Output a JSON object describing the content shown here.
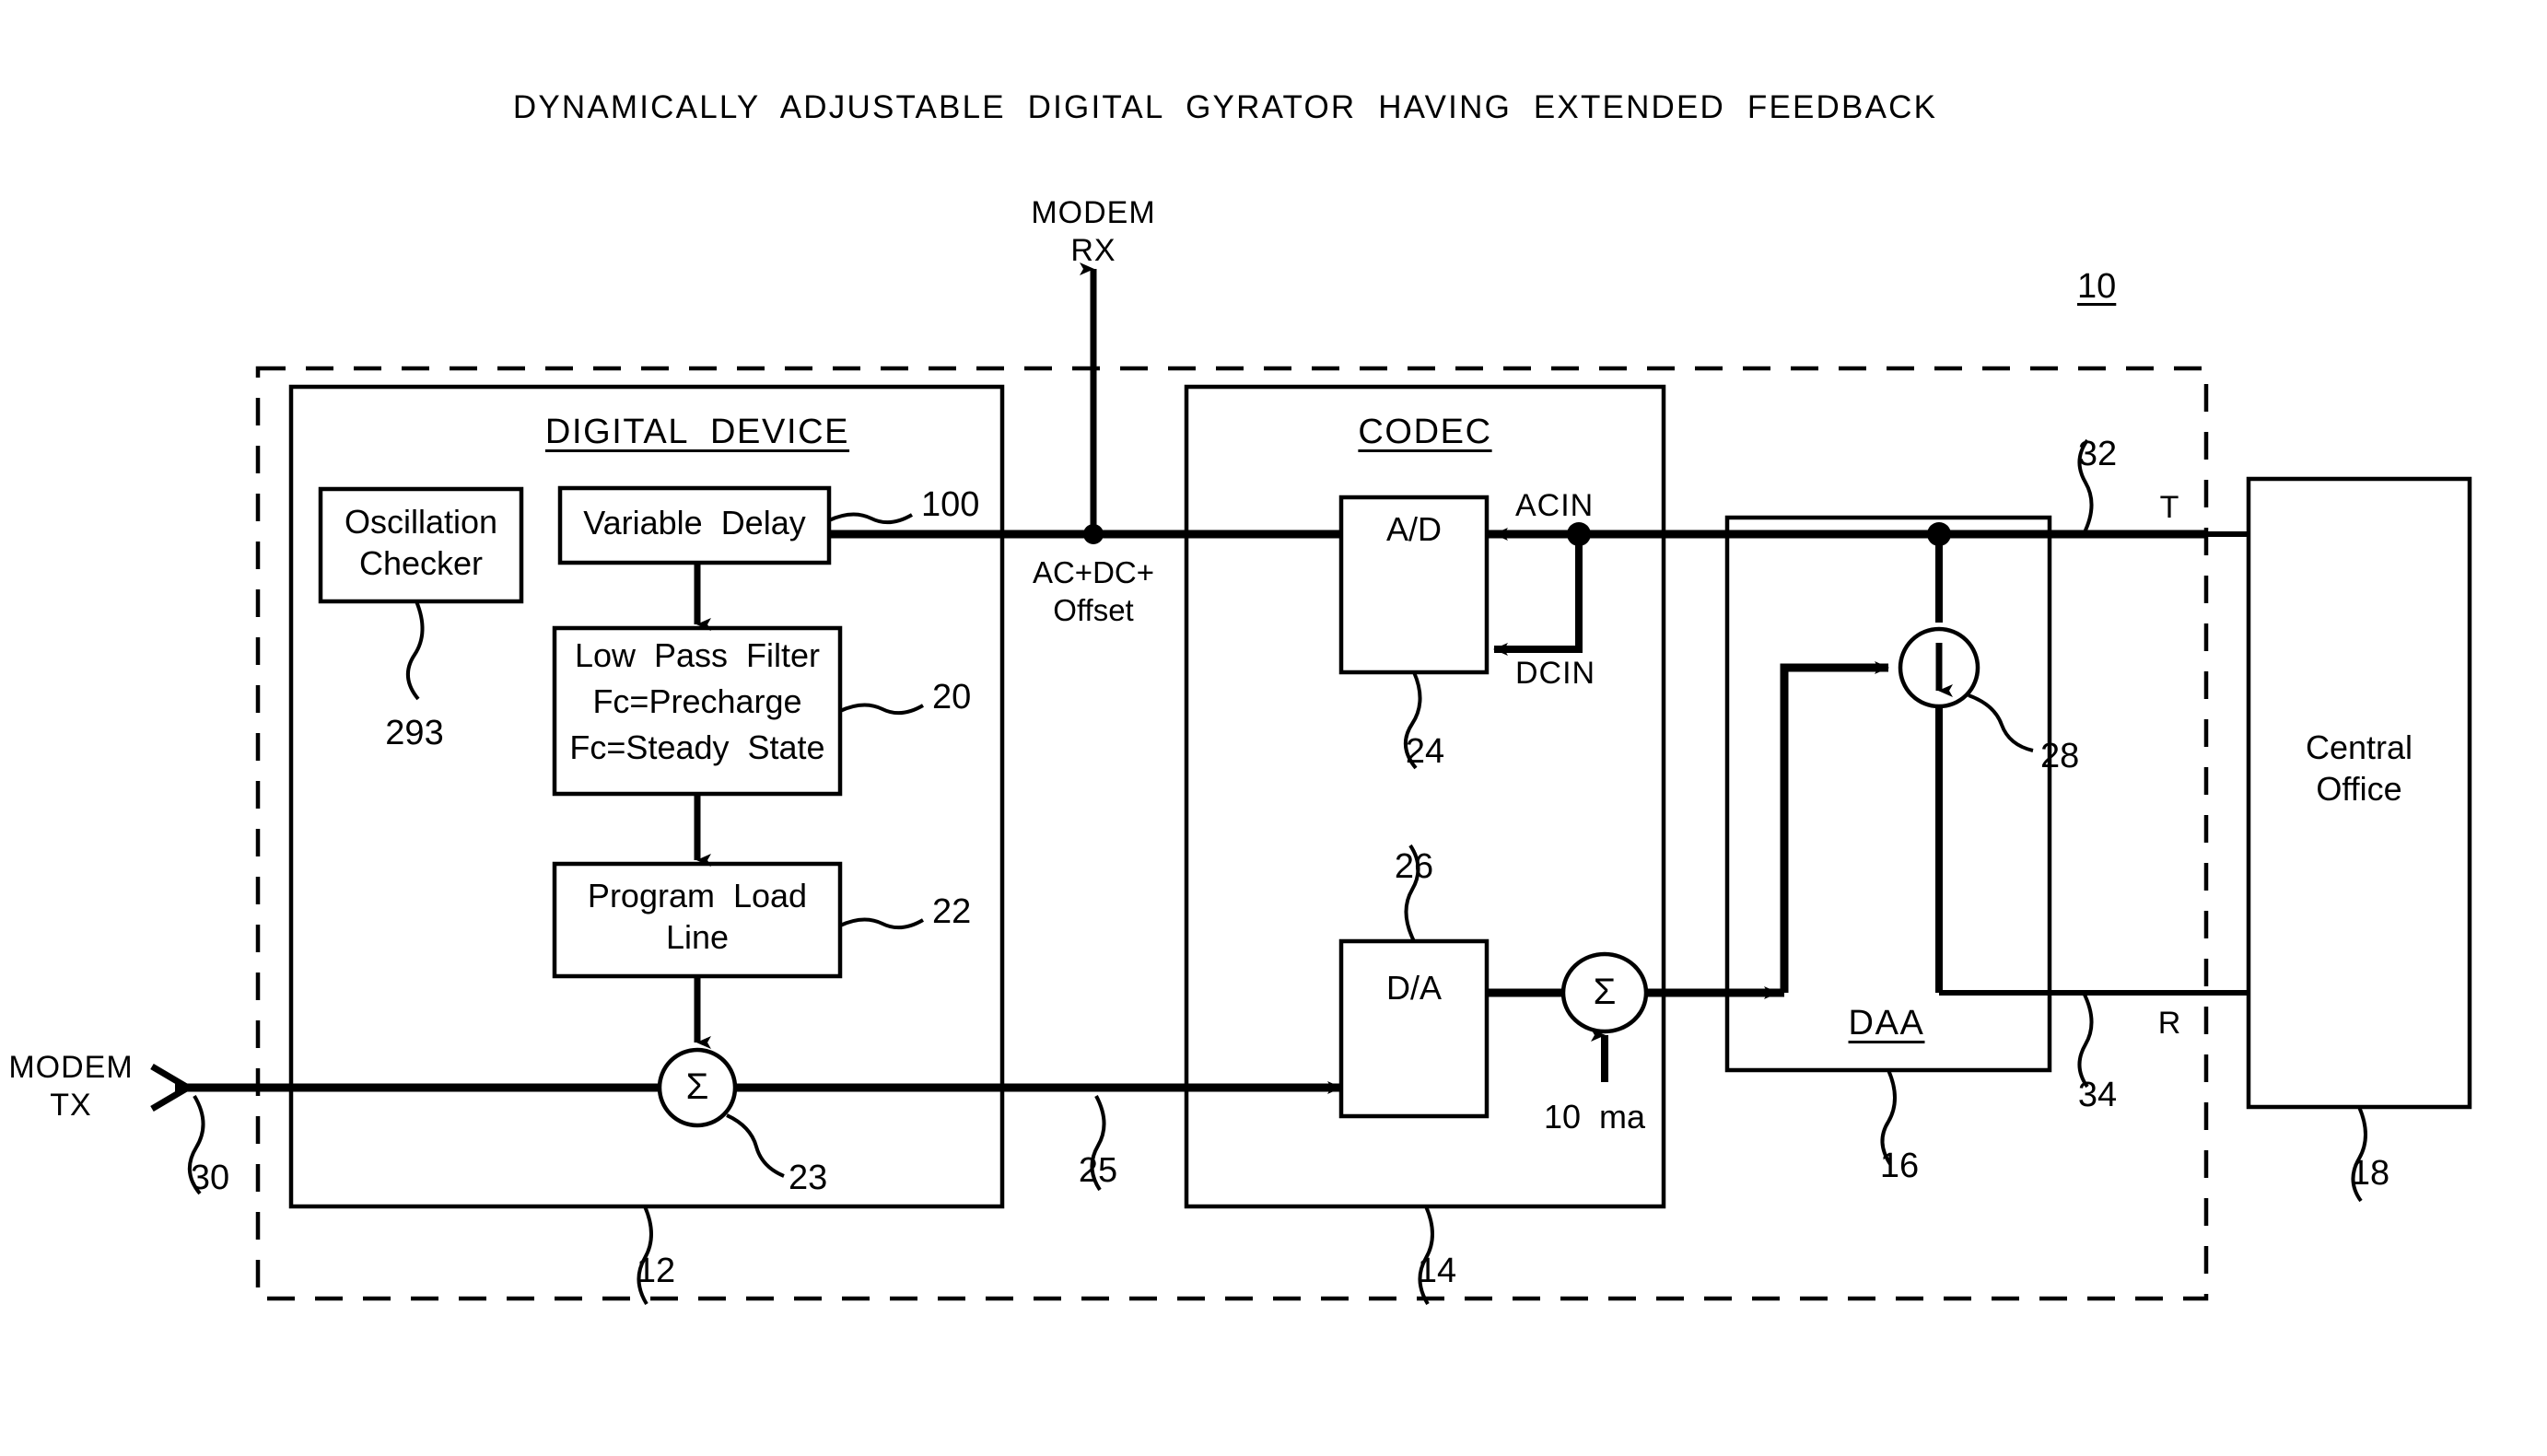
{
  "figure": {
    "title": "DYNAMICALLY  ADJUSTABLE  DIGITAL  GYRATOR  HAVING  EXTENDED  FEEDBACK",
    "overall_ref": "10"
  },
  "ports": {
    "modem_rx_line1": "MODEM",
    "modem_rx_line2": "RX",
    "modem_tx_line1": "MODEM",
    "modem_tx_line2": "TX",
    "modem_tx_ref": "30",
    "tip_label": "T",
    "ring_label": "R",
    "tip_ref": "32",
    "ring_ref": "34"
  },
  "digital_device": {
    "header": "DIGITAL  DEVICE",
    "ref": "12",
    "blocks": [
      {
        "name": "oscillation-checker",
        "line1": "Oscillation",
        "line2": "Checker",
        "ref": "293"
      },
      {
        "name": "variable-delay",
        "line1": "Variable  Delay",
        "ref": "100"
      },
      {
        "name": "low-pass-filter",
        "line1": "Low  Pass  Filter",
        "line2": "Fc=Precharge",
        "line3": "Fc=Steady  State",
        "ref": "20"
      },
      {
        "name": "program-load-line",
        "line1": "Program  Load",
        "line2": "Line",
        "ref": "22"
      }
    ],
    "summer": {
      "glyph": "Σ",
      "ref": "23"
    }
  },
  "signal_labels": {
    "ac_dc_offset_line1": "AC+DC+",
    "ac_dc_offset_line2": "Offset",
    "tx_path_ref": "25"
  },
  "codec": {
    "header": "CODEC",
    "ref": "14",
    "ad": {
      "label": "A/D",
      "ref": "24"
    },
    "da": {
      "label": "D/A",
      "ref": "26"
    },
    "acin": "ACIN",
    "dcin": "DCIN",
    "summer": {
      "glyph": "Σ"
    },
    "bias": "10  ma"
  },
  "daa": {
    "header": "DAA",
    "ref": "16",
    "current_source_ref": "28"
  },
  "central_office": {
    "line1": "Central",
    "line2": "Office",
    "ref": "18"
  },
  "colors": {
    "ink": "#000000",
    "paper": "#ffffff"
  }
}
